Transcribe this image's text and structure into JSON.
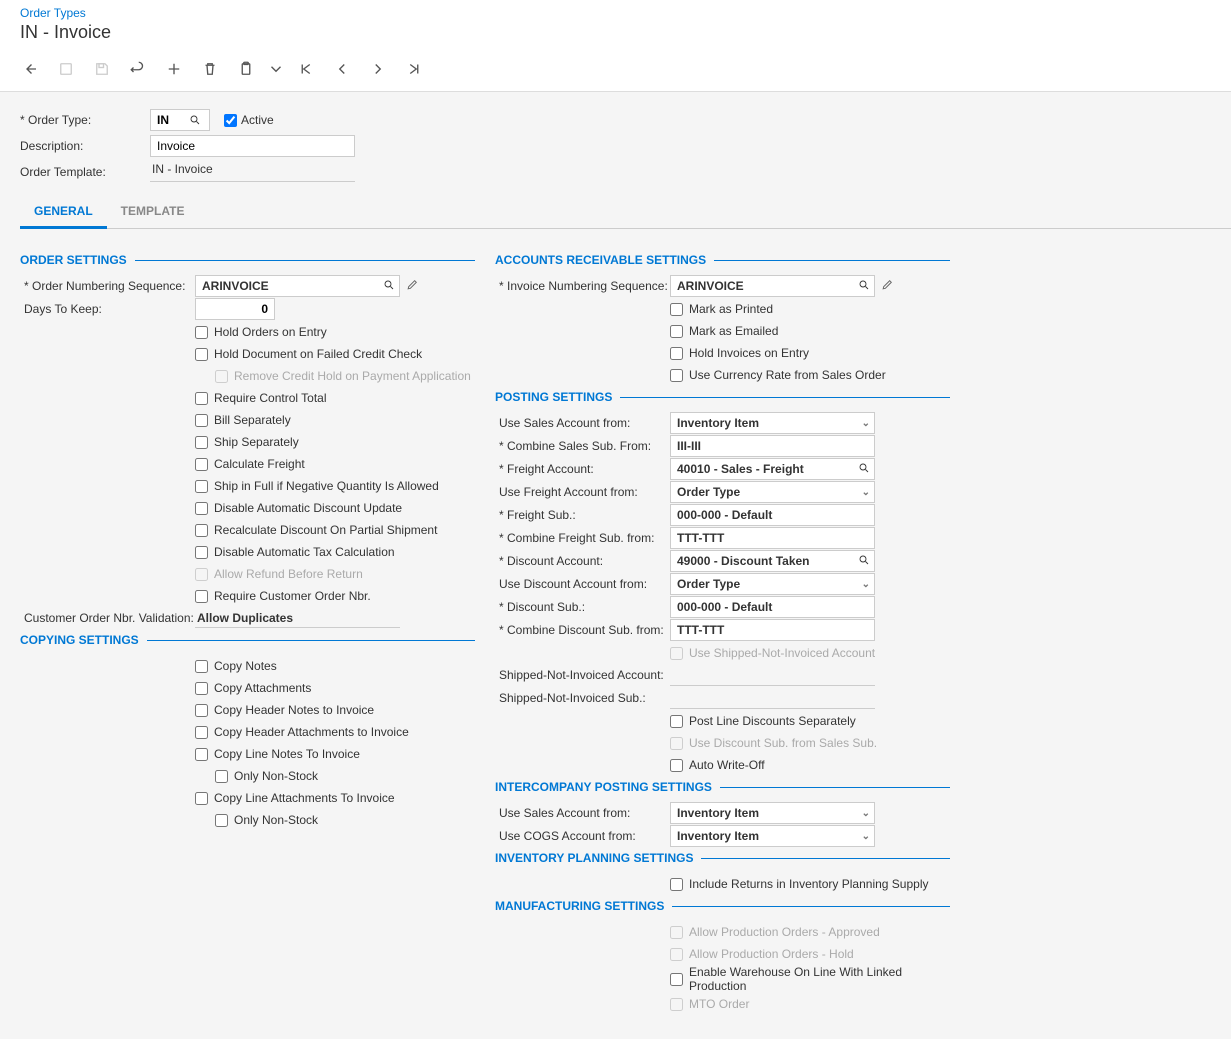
{
  "breadcrumb": "Order Types",
  "title": "IN - Invoice",
  "header": {
    "orderTypeLabel": "Order Type:",
    "orderTypeValue": "IN",
    "activeLabel": "Active",
    "descriptionLabel": "Description:",
    "descriptionValue": "Invoice",
    "orderTemplateLabel": "Order Template:",
    "orderTemplateValue": "IN - Invoice"
  },
  "tabs": {
    "general": "GENERAL",
    "template": "TEMPLATE"
  },
  "orderSettings": {
    "title": "ORDER SETTINGS",
    "orderNumSeqLabel": "Order Numbering Sequence:",
    "orderNumSeqValue": "ARINVOICE",
    "daysToKeepLabel": "Days To Keep:",
    "daysToKeepValue": "0",
    "holdOrders": "Hold Orders on Entry",
    "holdDocCredit": "Hold Document on Failed Credit Check",
    "removeCreditHold": "Remove Credit Hold on Payment Application",
    "requireControl": "Require Control Total",
    "billSep": "Bill Separately",
    "shipSep": "Ship Separately",
    "calcFreight": "Calculate Freight",
    "shipFullNeg": "Ship in Full if Negative Quantity Is Allowed",
    "disableAutoDisc": "Disable Automatic Discount Update",
    "recalcDisc": "Recalculate Discount On Partial Shipment",
    "disableAutoTax": "Disable Automatic Tax Calculation",
    "allowRefund": "Allow Refund Before Return",
    "requireCustOrd": "Require Customer Order Nbr.",
    "custOrdValidLabel": "Customer Order Nbr. Validation:",
    "custOrdValidValue": "Allow Duplicates"
  },
  "copyingSettings": {
    "title": "COPYING SETTINGS",
    "copyNotes": "Copy Notes",
    "copyAttach": "Copy Attachments",
    "copyHdrNotes": "Copy Header Notes to Invoice",
    "copyHdrAttach": "Copy Header Attachments to Invoice",
    "copyLineNotes": "Copy Line Notes To Invoice",
    "onlyNonStock1": "Only Non-Stock",
    "copyLineAttach": "Copy Line Attachments To Invoice",
    "onlyNonStock2": "Only Non-Stock"
  },
  "arSettings": {
    "title": "ACCOUNTS RECEIVABLE SETTINGS",
    "invNumSeqLabel": "Invoice Numbering Sequence:",
    "invNumSeqValue": "ARINVOICE",
    "markPrinted": "Mark as Printed",
    "markEmailed": "Mark as Emailed",
    "holdInvoices": "Hold Invoices on Entry",
    "useCurrRate": "Use Currency Rate from Sales Order"
  },
  "postingSettings": {
    "title": "POSTING SETTINGS",
    "useSalesAcctLabel": "Use Sales Account from:",
    "useSalesAcctValue": "Inventory Item",
    "combineSalesSubLabel": "Combine Sales Sub. From:",
    "combineSalesSubValue": "III-III",
    "freightAcctLabel": "Freight Account:",
    "freightAcctValue": "40010 - Sales - Freight",
    "useFreightAcctLabel": "Use Freight Account from:",
    "useFreightAcctValue": "Order Type",
    "freightSubLabel": "Freight Sub.:",
    "freightSubValue": "000-000 - Default",
    "combineFreightSubLabel": "Combine Freight Sub. from:",
    "combineFreightSubValue": "TTT-TTT",
    "discountAcctLabel": "Discount Account:",
    "discountAcctValue": "49000 - Discount Taken",
    "useDiscountAcctLabel": "Use Discount Account from:",
    "useDiscountAcctValue": "Order Type",
    "discountSubLabel": "Discount Sub.:",
    "discountSubValue": "000-000 - Default",
    "combineDiscountSubLabel": "Combine Discount Sub. from:",
    "combineDiscountSubValue": "TTT-TTT",
    "useShippedNotInv": "Use Shipped-Not-Invoiced Account",
    "shippedNotInvAcctLabel": "Shipped-Not-Invoiced Account:",
    "shippedNotInvSubLabel": "Shipped-Not-Invoiced Sub.:",
    "postLineDisc": "Post Line Discounts Separately",
    "useDiscSubSales": "Use Discount Sub. from Sales Sub.",
    "autoWriteOff": "Auto Write-Off"
  },
  "intercompany": {
    "title": "INTERCOMPANY POSTING SETTINGS",
    "useSalesAcctLabel": "Use Sales Account from:",
    "useSalesAcctValue": "Inventory Item",
    "useCogsAcctLabel": "Use COGS Account from:",
    "useCogsAcctValue": "Inventory Item"
  },
  "invPlanning": {
    "title": "INVENTORY PLANNING SETTINGS",
    "includeReturns": "Include Returns in Inventory Planning Supply"
  },
  "manufacturing": {
    "title": "MANUFACTURING SETTINGS",
    "allowProdApproved": "Allow Production Orders - Approved",
    "allowProdHold": "Allow Production Orders - Hold",
    "enableWarehouse": "Enable Warehouse On Line With Linked Production",
    "mtoOrder": "MTO Order"
  }
}
